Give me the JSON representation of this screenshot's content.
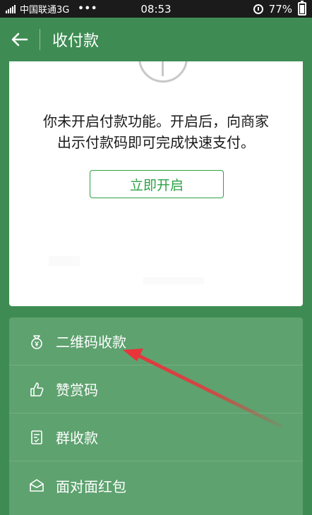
{
  "status_bar": {
    "carrier": "中国联通3G",
    "dots": "•••",
    "time": "08:53",
    "battery": "77%",
    "battery_level": 0.77,
    "icons": [
      "signal-icon",
      "alarm-icon",
      "battery-icon"
    ]
  },
  "nav": {
    "title": "收付款",
    "back_icon": "arrow-left-icon"
  },
  "pay_card": {
    "message_line1": "你未开启付款功能。开启后，向商家",
    "message_line2": "出示付款码即可完成快速支付。",
    "enable_button": "立即开启",
    "icon": "clock-icon"
  },
  "menu": {
    "items": [
      {
        "label": "二维码收款",
        "icon": "money-bag-icon"
      },
      {
        "label": "赞赏码",
        "icon": "thumbs-up-icon"
      },
      {
        "label": "群收款",
        "icon": "group-bill-icon"
      },
      {
        "label": "面对面红包",
        "icon": "red-packet-icon"
      }
    ]
  },
  "colors": {
    "header_green": "#3e8c53",
    "menu_green": "#5ea26f",
    "button_green": "#2ba245",
    "annotation_red": "#e8343a",
    "status_bar": "#1b1b1b"
  }
}
